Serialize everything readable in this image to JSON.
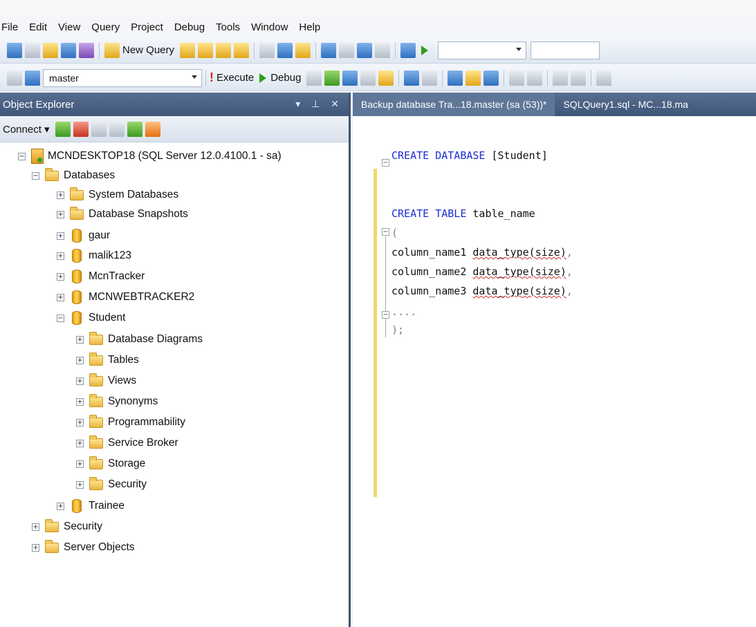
{
  "menu": [
    "File",
    "Edit",
    "View",
    "Query",
    "Project",
    "Debug",
    "Tools",
    "Window",
    "Help"
  ],
  "toolbar1": {
    "new_query_label": "New Query"
  },
  "toolbar2": {
    "database_value": "master",
    "execute_label": "Execute",
    "debug_label": "Debug"
  },
  "object_explorer": {
    "title": "Object Explorer",
    "pin_close": "▾ ⊥ ✕",
    "connect_label": "Connect ▾",
    "server": "MCNDESKTOP18 (SQL Server 12.0.4100.1 - sa)",
    "databases_label": "Databases",
    "system_databases": "System Databases",
    "database_snapshots": "Database Snapshots",
    "db_gaur": "gaur",
    "db_malik": "malik123",
    "db_mcntracker": "McnTracker",
    "db_webtracker": "MCNWEBTRACKER2",
    "db_student": "Student",
    "student_children": [
      "Database Diagrams",
      "Tables",
      "Views",
      "Synonyms",
      "Programmability",
      "Service Broker",
      "Storage",
      "Security"
    ],
    "db_trainee": "Trainee",
    "security": "Security",
    "server_objects": "Server Objects"
  },
  "tabs": [
    "Backup database Tra...18.master (sa (53))*",
    "SQLQuery1.sql - MC...18.ma"
  ],
  "code": {
    "l1_kw": "CREATE DATABASE",
    "l1_rest": " [Student]",
    "l2_kw": "CREATE TABLE",
    "l2_rest": " table_name",
    "l3": "(",
    "col1_name": "column_name1 ",
    "col2_name": "column_name2 ",
    "col3_name": "column_name3 ",
    "col_type": "data_type(size)",
    "comma": ",",
    "l7": "....",
    "l8": ");"
  }
}
